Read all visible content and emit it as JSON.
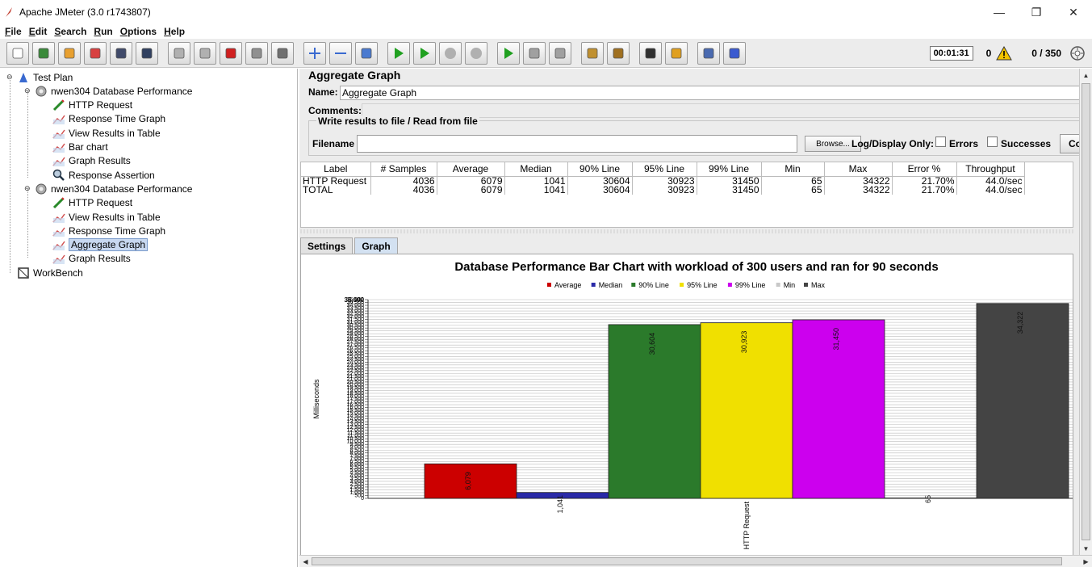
{
  "window": {
    "title": "Apache JMeter (3.0 r1743807)",
    "minimize": "—",
    "restore": "❐",
    "close": "✕"
  },
  "menu": [
    {
      "label": "File",
      "u": "F",
      "rest": "ile"
    },
    {
      "label": "Edit",
      "u": "E",
      "rest": "dit"
    },
    {
      "label": "Search",
      "u": "S",
      "rest": "earch"
    },
    {
      "label": "Run",
      "u": "R",
      "rest": "un"
    },
    {
      "label": "Options",
      "u": "O",
      "rest": "ptions"
    },
    {
      "label": "Help",
      "u": "H",
      "rest": "elp"
    }
  ],
  "toolbar": {
    "elapsed": "00:01:31",
    "warnings": "0",
    "threads": "0 / 350",
    "icons": [
      "new-icon",
      "templates-icon",
      "open-icon",
      "close-icon",
      "save-icon",
      "save-as-icon",
      "undo-icon",
      "redo-icon",
      "cut-icon",
      "copy-icon",
      "paste-icon",
      "expand-icon",
      "collapse-icon",
      "toggle-icon",
      "start-icon",
      "start-no-pause-icon",
      "stop-icon",
      "shutdown-icon",
      "remote-start-icon",
      "remote-stop-icon",
      "remote-shutdown-icon",
      "clear-icon",
      "clear-all-icon",
      "search-icon",
      "reset-search-icon",
      "function-helper-icon",
      "help-icon"
    ]
  },
  "tree": [
    {
      "label": "Test Plan",
      "icon": "test-plan-icon",
      "level": 0,
      "expander": "⊖"
    },
    {
      "label": "nwen304  Database Performance",
      "icon": "thread-group-icon",
      "level": 1,
      "expander": "⊖"
    },
    {
      "label": "HTTP Request",
      "icon": "http-sampler-icon",
      "level": 2
    },
    {
      "label": "Response Time Graph",
      "icon": "listener-icon",
      "level": 2
    },
    {
      "label": "View Results in Table",
      "icon": "listener-icon",
      "level": 2
    },
    {
      "label": "Bar chart",
      "icon": "listener-icon",
      "level": 2
    },
    {
      "label": "Graph Results",
      "icon": "listener-icon",
      "level": 2
    },
    {
      "label": "Response Assertion",
      "icon": "assertion-icon",
      "level": 2
    },
    {
      "label": "nwen304  Database Performance",
      "icon": "thread-group-icon",
      "level": 1,
      "expander": "⊖"
    },
    {
      "label": "HTTP Request",
      "icon": "http-sampler-icon",
      "level": 2
    },
    {
      "label": "View Results in Table",
      "icon": "listener-icon",
      "level": 2
    },
    {
      "label": "Response Time Graph",
      "icon": "listener-icon",
      "level": 2
    },
    {
      "label": "Aggregate Graph",
      "icon": "listener-icon",
      "level": 2,
      "selected": true
    },
    {
      "label": "Graph Results",
      "icon": "listener-icon",
      "level": 2
    },
    {
      "label": "WorkBench",
      "icon": "workbench-icon",
      "level": 0
    }
  ],
  "panel": {
    "title": "Aggregate Graph",
    "name_label": "Name:",
    "name_value": "Aggregate Graph",
    "comments_label": "Comments:",
    "file_group_legend": "Write results to file / Read from file",
    "filename_label": "Filename",
    "filename_value": "",
    "browse_label": "Browse...",
    "log_display_label": "Log/Display Only:",
    "errors_label": "Errors",
    "successes_label": "Successes",
    "configure_label": "Co"
  },
  "table": {
    "columns": [
      "Label",
      "# Samples",
      "Average",
      "Median",
      "90% Line",
      "95% Line",
      "99% Line",
      "Min",
      "Max",
      "Error %",
      "Throughput"
    ],
    "rows": [
      [
        "HTTP Request",
        "4036",
        "6079",
        "1041",
        "30604",
        "30923",
        "31450",
        "65",
        "34322",
        "21.70%",
        "44.0/sec"
      ],
      [
        "TOTAL",
        "4036",
        "6079",
        "1041",
        "30604",
        "30923",
        "31450",
        "65",
        "34322",
        "21.70%",
        "44.0/sec"
      ]
    ]
  },
  "tabs": [
    {
      "label": "Settings",
      "active": false
    },
    {
      "label": "Graph",
      "active": true
    }
  ],
  "chart_data": {
    "type": "bar",
    "title": "Database Performance Bar Chart with workload of 300 users and ran for 90 seconds",
    "ylabel": "Milliseconds",
    "xlabel": "",
    "categories": [
      "HTTP Request"
    ],
    "ylim": [
      0,
      35000
    ],
    "y_top_tick": "35,000",
    "legend_position": "top-center",
    "grid": true,
    "series": [
      {
        "name": "Average",
        "values": [
          6079
        ],
        "label": "6,079",
        "color": "#cc0000"
      },
      {
        "name": "Median",
        "values": [
          1041
        ],
        "label": "1,041",
        "color": "#2a2aa8"
      },
      {
        "name": "90% Line",
        "values": [
          30604
        ],
        "label": "30,604",
        "color": "#2b7a2b"
      },
      {
        "name": "95% Line",
        "values": [
          30923
        ],
        "label": "30,923",
        "color": "#f0e000"
      },
      {
        "name": "99% Line",
        "values": [
          31450
        ],
        "label": "31,450",
        "color": "#cc00ee"
      },
      {
        "name": "Min",
        "values": [
          65
        ],
        "label": "65",
        "color": "#c8c8c8"
      },
      {
        "name": "Max",
        "values": [
          34322
        ],
        "label": "34,322",
        "color": "#444444"
      }
    ]
  }
}
